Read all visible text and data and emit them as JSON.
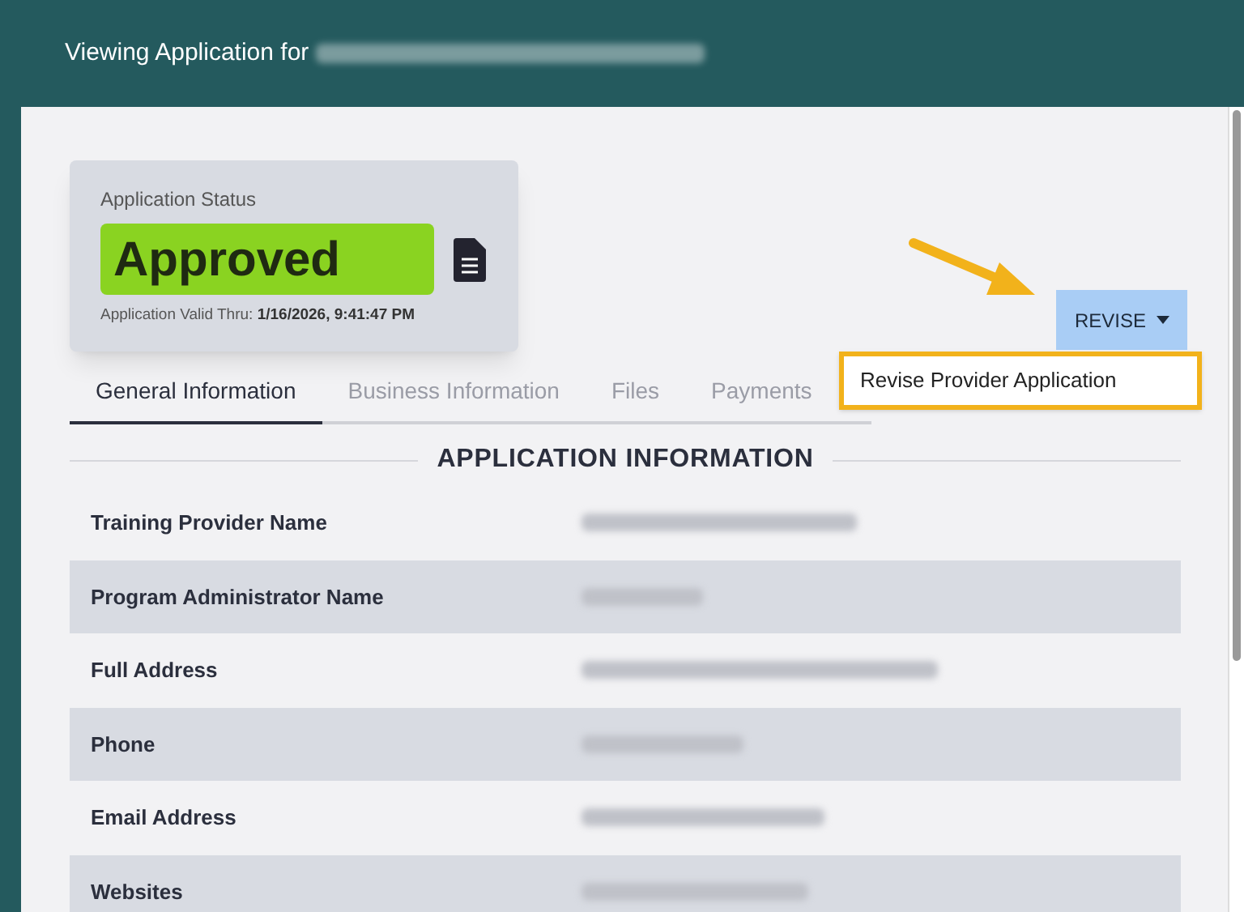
{
  "header": {
    "title": "Viewing Application for"
  },
  "status_card": {
    "label": "Application Status",
    "status": "Approved",
    "valid_label": "Application Valid Thru:",
    "valid_value": "1/16/2026, 9:41:47 PM"
  },
  "tabs": [
    {
      "label": "General Information",
      "selected": true
    },
    {
      "label": "Business Information",
      "selected": false
    },
    {
      "label": "Files",
      "selected": false
    },
    {
      "label": "Payments",
      "selected": false
    }
  ],
  "revise_button": {
    "label": "REVISE"
  },
  "revise_menu": [
    {
      "label": "Revise Provider Application",
      "highlighted": true
    }
  ],
  "section": {
    "title": "APPLICATION INFORMATION"
  },
  "rows": [
    {
      "label": "Training Provider Name"
    },
    {
      "label": "Program Administrator Name"
    },
    {
      "label": "Full Address"
    },
    {
      "label": "Phone"
    },
    {
      "label": "Email Address"
    },
    {
      "label": "Websites"
    }
  ]
}
